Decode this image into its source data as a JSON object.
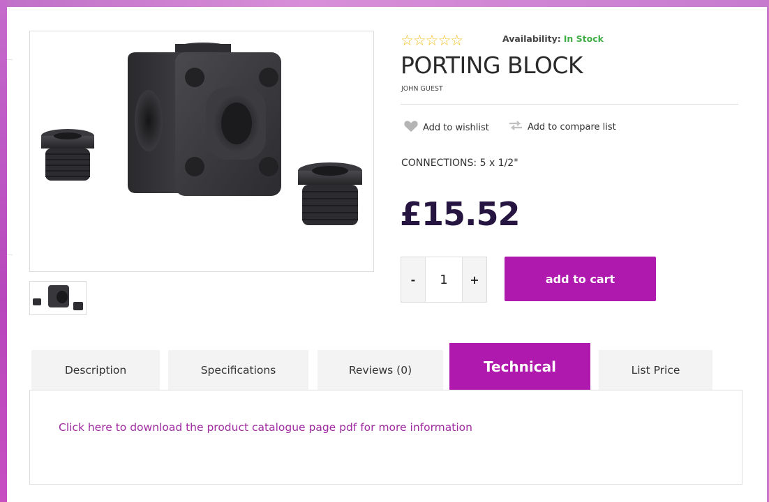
{
  "product": {
    "title": "PORTING BLOCK",
    "brand": "JOHN GUEST",
    "rating_stars": "☆☆☆☆☆",
    "availability_label": "Availability:",
    "availability_status": "In Stock",
    "connections": "CONNECTIONS: 5 x 1/2\"",
    "price": "£15.52"
  },
  "actions": {
    "wishlist_label": "Add to wishlist",
    "compare_label": "Add to compare list",
    "qty_minus": "-",
    "qty_value": "1",
    "qty_plus": "+",
    "add_to_cart": "add to cart"
  },
  "tabs": [
    {
      "label": "Description"
    },
    {
      "label": "Specifications"
    },
    {
      "label": "Reviews (0)"
    },
    {
      "label": "Technical"
    },
    {
      "label": "List Price"
    }
  ],
  "technical": {
    "link_text": "Click here to download the product catalogue page pdf for more information"
  },
  "colors": {
    "accent": "#b019ad",
    "price": "#261541",
    "in_stock": "#3fae45",
    "star": "#f2c01e"
  },
  "icons": [
    "heart-icon",
    "compare-arrows-icon",
    "star-icon"
  ]
}
